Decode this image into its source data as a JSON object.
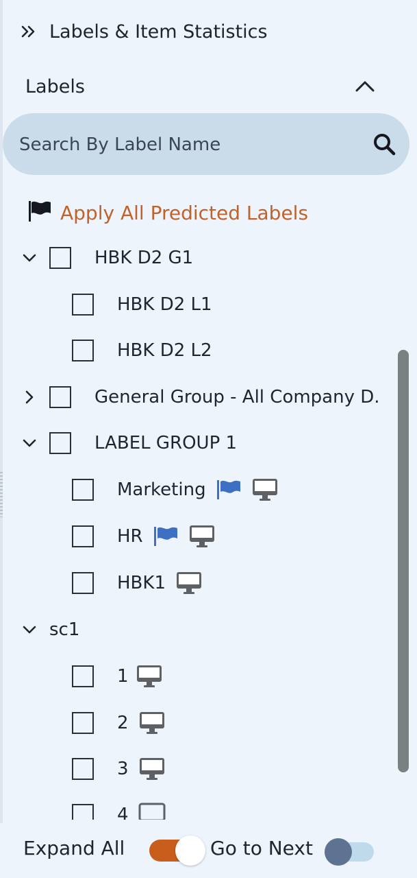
{
  "header": {
    "title": "Labels & Item Statistics",
    "icon": "double-chevron-right-icon"
  },
  "labels_section": {
    "title": "Labels",
    "collapse_icon": "chevron-up-icon"
  },
  "search": {
    "placeholder": "Search By Label Name",
    "value": "",
    "icon": "search-icon"
  },
  "apply_predicted": {
    "label": "Apply All Predicted Labels",
    "icon": "flag-icon",
    "color": "#c0622a"
  },
  "tree": [
    {
      "type": "group",
      "label": "HBK D2 G1",
      "expanded": true,
      "checked": false
    },
    {
      "type": "item",
      "label": "HBK D2 L1",
      "checked": false,
      "flag": false,
      "device": false
    },
    {
      "type": "item",
      "label": "HBK D2 L2",
      "checked": false,
      "flag": false,
      "device": false
    },
    {
      "type": "group",
      "label": "General Group - All Company D.",
      "expanded": false,
      "checked": false
    },
    {
      "type": "group",
      "label": "LABEL GROUP 1",
      "expanded": true,
      "checked": false
    },
    {
      "type": "item",
      "label": "Marketing",
      "checked": false,
      "flag": true,
      "device": true
    },
    {
      "type": "item",
      "label": "HR",
      "checked": false,
      "flag": true,
      "device": true
    },
    {
      "type": "item",
      "label": "HBK1",
      "checked": false,
      "flag": false,
      "device": true
    },
    {
      "type": "group",
      "label": "sc1",
      "expanded": true,
      "checked": null
    },
    {
      "type": "item",
      "label": "1",
      "checked": false,
      "flag": false,
      "device": true
    },
    {
      "type": "item",
      "label": "2",
      "checked": false,
      "flag": false,
      "device": true
    },
    {
      "type": "item",
      "label": "3",
      "checked": false,
      "flag": false,
      "device": true
    },
    {
      "type": "item",
      "label": "4",
      "checked": false,
      "flag": false,
      "device": true
    }
  ],
  "footer": {
    "expand_all_label": "Expand All",
    "expand_all_on": true,
    "go_to_next_label": "Go to Next",
    "go_to_next_on": false
  },
  "colors": {
    "accent_orange": "#c95e1c",
    "flag_blue": "#3d6fc2",
    "device_gray": "#5f6063",
    "panel_bg": "#eef4fc",
    "search_bg": "#cadcea"
  }
}
